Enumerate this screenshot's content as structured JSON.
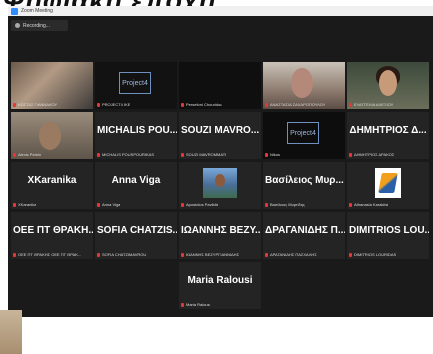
{
  "headline": "Ψηφιακή εποχή",
  "window": {
    "title": "Zoom Meeting",
    "recording_label": "Recording..."
  },
  "participants": [
    [
      {
        "name": "",
        "label": "ΚΩΣΤΑΣ ΓΙΑΝΝΑΚΟΥ",
        "video": "vid1"
      },
      {
        "name": "",
        "label": "PROJECT4 IKE",
        "video": "vid2",
        "logo": "Project4"
      },
      {
        "name": "",
        "label": "Persefoni Chouridou",
        "video": "vid3"
      },
      {
        "name": "",
        "label": "ΑΝΑΣΤΑΣΙΑ ΖΑΧΑΡΟΠΟΥΛΟΥ",
        "video": "vid4"
      },
      {
        "name": "",
        "label": "ΕΥΑΓΓΕΛΙΑ ΑΛΕΞΙΟΥ",
        "video": "vid5"
      }
    ],
    [
      {
        "name": "",
        "label": "Alexis Perkin",
        "video": "vid6",
        "active": true
      },
      {
        "name": "MICHALIS POU...",
        "label": "MICHALIS POUSPOURIKAS"
      },
      {
        "name": "SOUZI MAVRO...",
        "label": "SOUZI MAVROMMATI"
      },
      {
        "name": "",
        "label": "Nikos",
        "video": "vid7",
        "logo": "Project4"
      },
      {
        "name": "ΔΗΜΗΤΡΙΟΣ Δ...",
        "label": "ΔΗΜΗΤΡΙΟΣ ΔΡΑΚΟΣ"
      }
    ],
    [
      {
        "name": "XKaranika",
        "label": "XKaranika"
      },
      {
        "name": "Anna Viga",
        "label": "Anna Viga"
      },
      {
        "name": "",
        "label": "Apostolos Pavlidis",
        "video": "vid8"
      },
      {
        "name": "Βασίλειος Μυρ...",
        "label": "Βασίλειος Μυρτίδης"
      },
      {
        "name": "",
        "label": "Athanasia Karakitsi",
        "video": "vid9"
      }
    ],
    [
      {
        "name": "ΟΕΕ ΠΤ ΘΡΑΚΗ...",
        "label": "ΟΕΕ ΠΤ ΘΡΑΚΗΣ ΟΕΕ ΠΤ ΘΡΑΚ..."
      },
      {
        "name": "SOFIA CHATZIS...",
        "label": "SOFIA CHATZIMAVROU"
      },
      {
        "name": "ΙΩΑΝΝΗΣ ΒΕΖΥ...",
        "label": "ΙΩΑΝΝΗΣ ΒΕΖΥΡΓΙΑΝΝΙΔΗΣ"
      },
      {
        "name": "ΔΡΑΓΑΝΙΔΗΣ Π...",
        "label": "ΔΡΑΓΑΝΙΔΗΣ ΠΑΣΧΑΛΗΣ"
      },
      {
        "name": "DIMITRIOS LOU...",
        "label": "DIMITRIOS LOURIDAS"
      }
    ],
    [
      {
        "name": "Maria Ralousi",
        "label": "Maria Ralousi"
      }
    ]
  ]
}
